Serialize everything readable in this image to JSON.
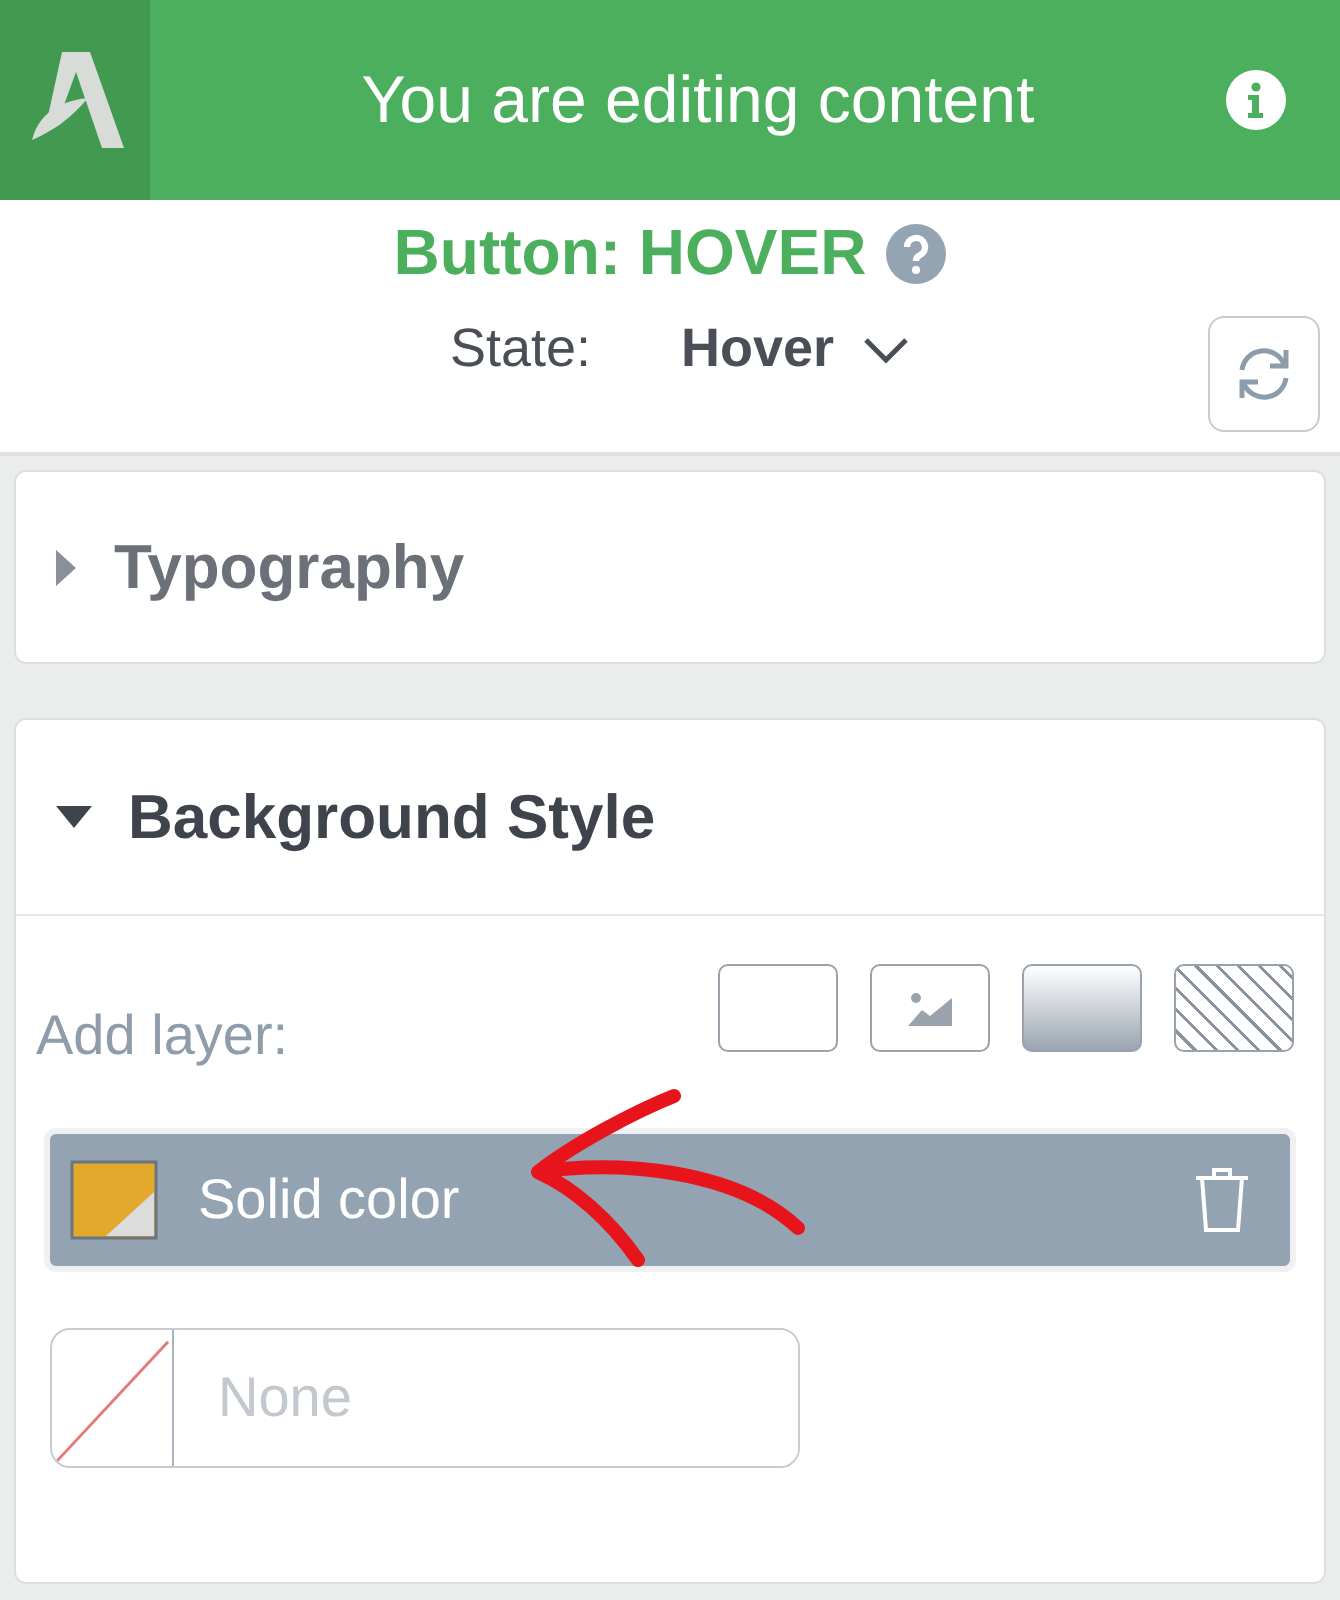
{
  "header": {
    "title": "You are editing content"
  },
  "element_title": "Button: HOVER",
  "state": {
    "label": "State:",
    "value": "Hover"
  },
  "sections": [
    {
      "title": "Typography",
      "expanded": false
    },
    {
      "title": "Background Style",
      "expanded": true,
      "add_layer_label": "Add layer:",
      "layer_types": [
        {
          "kind": "color"
        },
        {
          "kind": "image"
        },
        {
          "kind": "gradient"
        },
        {
          "kind": "pattern"
        }
      ],
      "layers": [
        {
          "label": "Solid color"
        }
      ],
      "color_field": {
        "placeholder": "None"
      }
    }
  ]
}
